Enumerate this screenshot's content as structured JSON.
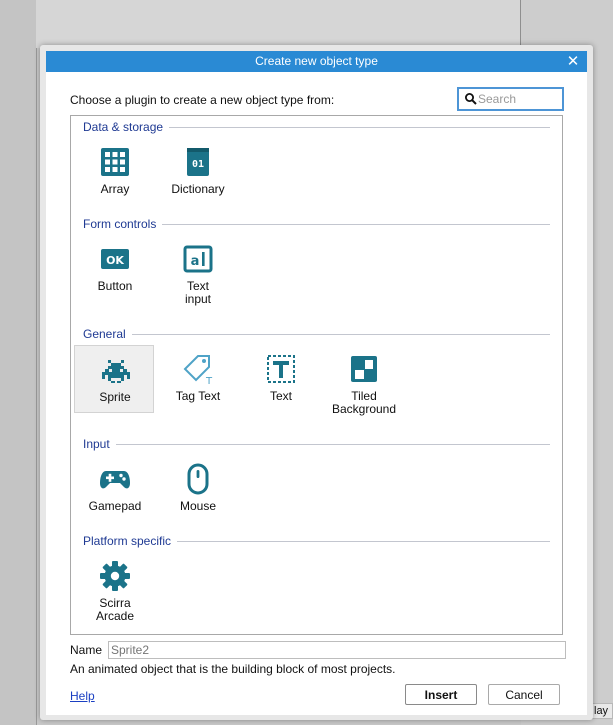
{
  "dialog": {
    "title": "Create new object type",
    "prompt": "Choose a plugin to create a new object type from:",
    "search_placeholder": "Search",
    "name_label": "Name",
    "name_placeholder": "Sprite2",
    "description": "An animated object that is the building block of most projects.",
    "help_label": "Help",
    "insert_label": "Insert",
    "cancel_label": "Cancel"
  },
  "categories": [
    {
      "label": "Data & storage",
      "items": [
        {
          "label": "Array",
          "icon": "grid-icon"
        },
        {
          "label": "Dictionary",
          "icon": "book-icon"
        }
      ]
    },
    {
      "label": "Form controls",
      "items": [
        {
          "label": "Button",
          "icon": "ok-button-icon"
        },
        {
          "label": "Text\ninput",
          "icon": "text-input-icon"
        }
      ]
    },
    {
      "label": "General",
      "items": [
        {
          "label": "Sprite",
          "icon": "space-invader-icon"
        },
        {
          "label": "Tag Text",
          "icon": "tag-icon"
        },
        {
          "label": "Text",
          "icon": "text-icon"
        },
        {
          "label": "Tiled\nBackground",
          "icon": "tiled-icon"
        }
      ]
    },
    {
      "label": "Input",
      "items": [
        {
          "label": "Gamepad",
          "icon": "gamepad-icon"
        },
        {
          "label": "Mouse",
          "icon": "mouse-icon"
        }
      ]
    },
    {
      "label": "Platform specific",
      "items": [
        {
          "label": "Scirra\nArcade",
          "icon": "gear-icon"
        }
      ]
    }
  ],
  "selected_item": "Sprite",
  "background": {
    "corner_text": "lay"
  },
  "colors": {
    "title_bar": "#2a8ad4",
    "icon": "#1b7389",
    "category": "#1f3a93",
    "link": "#1a3fc2"
  }
}
